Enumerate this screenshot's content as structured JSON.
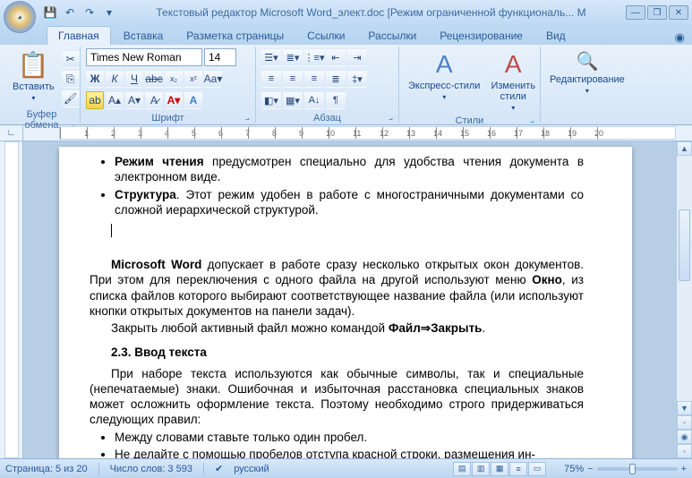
{
  "title": "Текстовый редактор Microsoft Word_элект.doc [Режим ограниченной функциональ... M",
  "qat": {
    "save": "💾",
    "undo": "↶",
    "redo": "↷",
    "more": "▾"
  },
  "win": {
    "min": "—",
    "restore": "❐",
    "close": "✕"
  },
  "tabs": [
    "Главная",
    "Вставка",
    "Разметка страницы",
    "Ссылки",
    "Рассылки",
    "Рецензирование",
    "Вид"
  ],
  "ribbon": {
    "clipboard": {
      "paste": "Вставить",
      "label": "Буфер обмена"
    },
    "font": {
      "name": "Times New Roman",
      "size": "14",
      "label": "Шрифт"
    },
    "paragraph": {
      "label": "Абзац"
    },
    "styles": {
      "quick": "Экспресс-стили",
      "change": "Изменить\nстили",
      "label": "Стили"
    },
    "editing": {
      "btn": "Редактирование"
    }
  },
  "document": {
    "li1_b": "Режим чтения",
    "li1_r": " предусмотрен специально для удобства чтения документа в электронном виде.",
    "li2_b": "Структура",
    "li2_r": ". Этот режим удобен в работе с многостраничными документами со сложной иерархической структурой.",
    "p1_b": "Microsoft Word",
    "p1_r": " допускает в работе сразу несколько открытых окон документов. При этом для переключения с одного файла на другой используют меню ",
    "p1_b2": "Окно",
    "p1_r2": ", из списка файлов которого выбирают соответствующее название файла (или используют кнопки открытых документов на панели задач).",
    "p2_a": "Закрыть любой активный файл можно командой ",
    "p2_b": "Файл⇒Закрыть",
    "h": "2.3. Ввод текста",
    "p3": "При наборе текста используются как обычные символы, так и специальные (непечатаемые) знаки. Ошибочная и избыточная расстановка специальных знаков может осложнить оформление текста. Поэтому необходимо строго придерживаться следующих правил:",
    "li3": "Между словами ставьте только один пробел.",
    "li4": "Не делайте с помощью пробелов отступа красной строки, размещения ин-"
  },
  "status": {
    "page": "Страница: 5 из 20",
    "words": "Число слов: 3 593",
    "lang": "русский",
    "zoom": "75%"
  }
}
